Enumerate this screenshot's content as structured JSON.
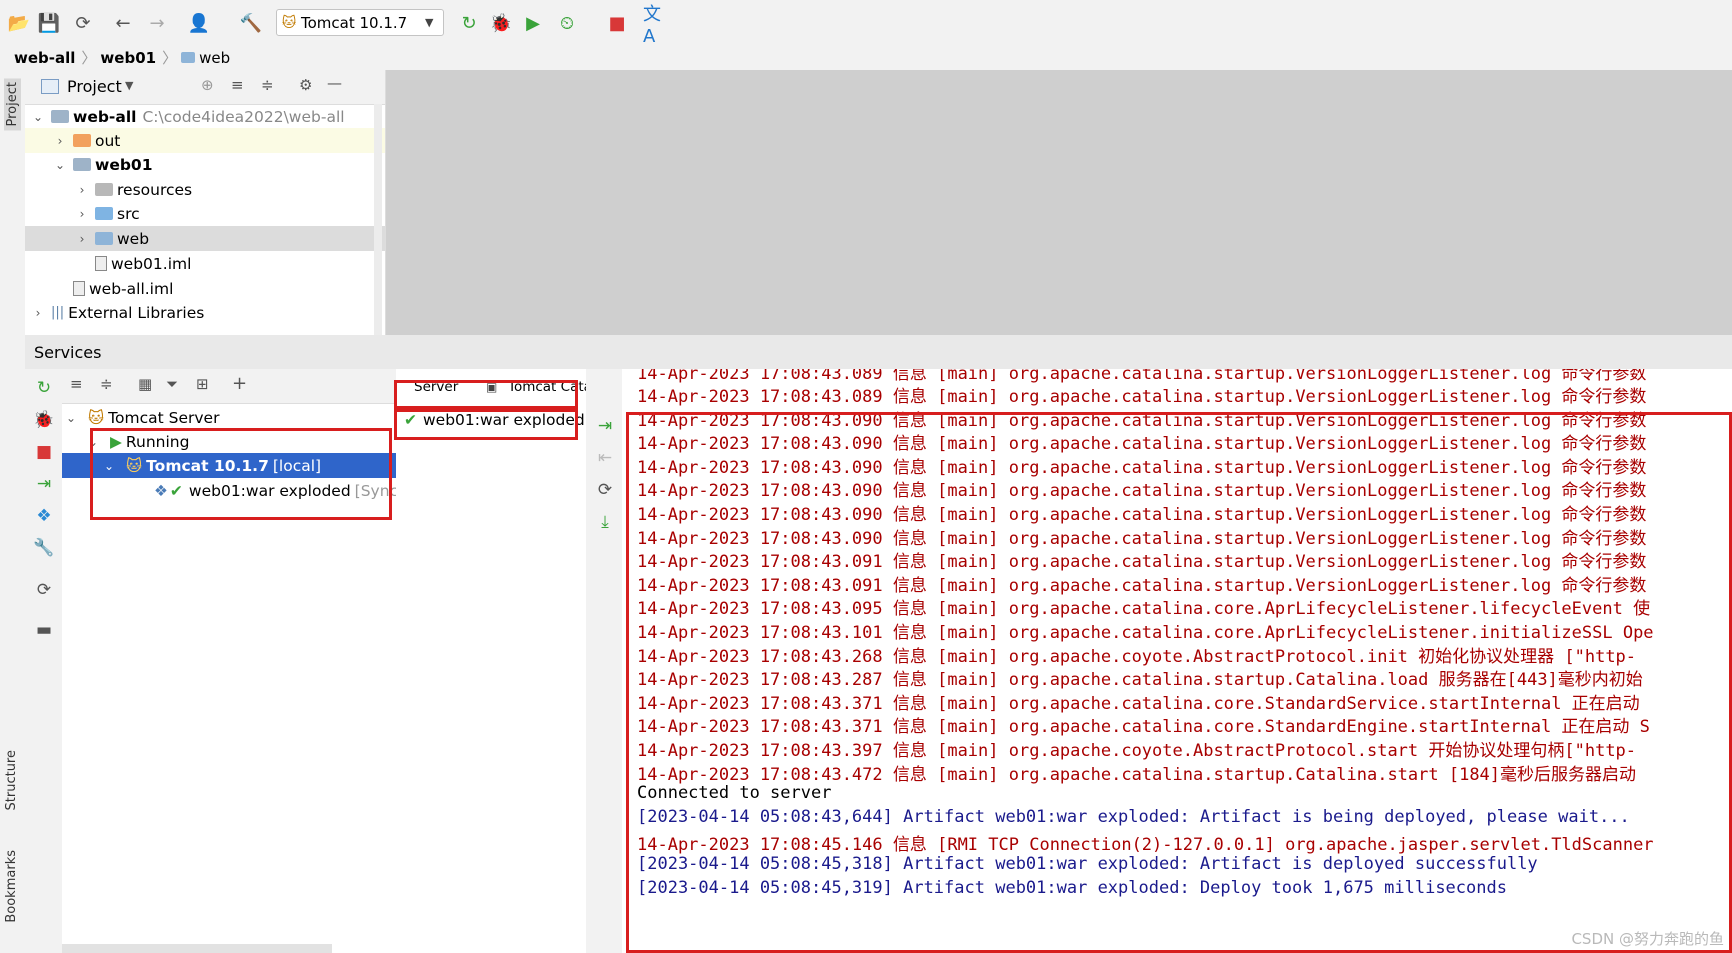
{
  "toolbar": {
    "run_config": "Tomcat 10.1.7",
    "icons": [
      "open-icon",
      "save-icon",
      "sync-icon",
      "back-icon",
      "forward-icon",
      "user-icon",
      "build-icon",
      "run-icon",
      "debug-icon",
      "coverage-icon",
      "profile-icon",
      "stop-icon",
      "translate-icon"
    ]
  },
  "breadcrumb": {
    "items": [
      "web-all",
      "web01",
      "web"
    ]
  },
  "left_strip": {
    "project_label": "Project",
    "structure_label": "Structure",
    "bookmarks_label": "Bookmarks"
  },
  "project": {
    "title": "Project",
    "tree": [
      {
        "label": "web-all",
        "extra": "C:\\code4idea2022\\web-all",
        "type": "module"
      },
      {
        "label": "out",
        "type": "folder-orange"
      },
      {
        "label": "web01",
        "type": "module"
      },
      {
        "label": "resources",
        "type": "folder-res"
      },
      {
        "label": "src",
        "type": "folder-blue"
      },
      {
        "label": "web",
        "type": "folder-web"
      },
      {
        "label": "web01.iml",
        "type": "file"
      },
      {
        "label": "web-all.iml",
        "type": "file"
      },
      {
        "label": "External Libraries",
        "type": "lib"
      }
    ]
  },
  "services": {
    "title": "Services",
    "tree": {
      "tomcat_server": "Tomcat Server",
      "running": "Running",
      "tomcat_instance": "Tomcat 10.1.7",
      "tomcat_instance_suffix": "[local]",
      "artifact": "web01:war exploded",
      "artifact_status": "[Sync"
    },
    "tabs": {
      "server": "Server",
      "catalina_log": "Tomcat Catalina Log"
    },
    "deployment": "web01:war exploded"
  },
  "console": {
    "lines": [
      {
        "text": "14-Apr-2023 17:08:43.089 信息 [main] org.apache.catalina.startup.VersionLoggerListener.log 命令行参数",
        "color": "red"
      },
      {
        "text": "14-Apr-2023 17:08:43.090 信息 [main] org.apache.catalina.startup.VersionLoggerListener.log 命令行参数",
        "color": "red"
      },
      {
        "text": "14-Apr-2023 17:08:43.090 信息 [main] org.apache.catalina.startup.VersionLoggerListener.log 命令行参数",
        "color": "red"
      },
      {
        "text": "14-Apr-2023 17:08:43.090 信息 [main] org.apache.catalina.startup.VersionLoggerListener.log 命令行参数",
        "color": "red"
      },
      {
        "text": "14-Apr-2023 17:08:43.090 信息 [main] org.apache.catalina.startup.VersionLoggerListener.log 命令行参数",
        "color": "red"
      },
      {
        "text": "14-Apr-2023 17:08:43.090 信息 [main] org.apache.catalina.startup.VersionLoggerListener.log 命令行参数",
        "color": "red"
      },
      {
        "text": "14-Apr-2023 17:08:43.090 信息 [main] org.apache.catalina.startup.VersionLoggerListener.log 命令行参数",
        "color": "red"
      },
      {
        "text": "14-Apr-2023 17:08:43.091 信息 [main] org.apache.catalina.startup.VersionLoggerListener.log 命令行参数",
        "color": "red"
      },
      {
        "text": "14-Apr-2023 17:08:43.091 信息 [main] org.apache.catalina.startup.VersionLoggerListener.log 命令行参数",
        "color": "red"
      },
      {
        "text": "14-Apr-2023 17:08:43.095 信息 [main] org.apache.catalina.core.AprLifecycleListener.lifecycleEvent 使",
        "color": "red"
      },
      {
        "text": "14-Apr-2023 17:08:43.101 信息 [main] org.apache.catalina.core.AprLifecycleListener.initializeSSL Ope",
        "color": "red"
      },
      {
        "text": "14-Apr-2023 17:08:43.268 信息 [main] org.apache.coyote.AbstractProtocol.init 初始化协议处理器 [\"http-",
        "color": "red"
      },
      {
        "text": "14-Apr-2023 17:08:43.287 信息 [main] org.apache.catalina.startup.Catalina.load 服务器在[443]毫秒内初始",
        "color": "red"
      },
      {
        "text": "14-Apr-2023 17:08:43.371 信息 [main] org.apache.catalina.core.StandardService.startInternal 正在启动",
        "color": "red"
      },
      {
        "text": "14-Apr-2023 17:08:43.371 信息 [main] org.apache.catalina.core.StandardEngine.startInternal 正在启动 S",
        "color": "red"
      },
      {
        "text": "14-Apr-2023 17:08:43.397 信息 [main] org.apache.coyote.AbstractProtocol.start 开始协议处理句柄[\"http-",
        "color": "red"
      },
      {
        "text": "14-Apr-2023 17:08:43.472 信息 [main] org.apache.catalina.startup.Catalina.start [184]毫秒后服务器启动",
        "color": "red"
      },
      {
        "text": "Connected to server",
        "color": "black"
      },
      {
        "text": "[2023-04-14 05:08:43,644] Artifact web01:war exploded: Artifact is being deployed, please wait...",
        "color": "blue"
      },
      {
        "text": "14-Apr-2023 17:08:45.146 信息 [RMI TCP Connection(2)-127.0.0.1] org.apache.jasper.servlet.TldScanner",
        "color": "red"
      },
      {
        "text": "[2023-04-14 05:08:45,318] Artifact web01:war exploded: Artifact is deployed successfully",
        "color": "blue"
      },
      {
        "text": "[2023-04-14 05:08:45,319] Artifact web01:war exploded: Deploy took 1,675 milliseconds",
        "color": "blue"
      }
    ],
    "partial_top_line": "14-Apr-2023 17:08:43.089 信息 [main] org.apache.catalina.startup.VersionLoggerListener.log 命令行参数"
  },
  "watermark": "CSDN @努力奔跑的鱼",
  "colors": {
    "selection": "#2f65ca",
    "log_red": "#a80000",
    "log_blue": "#1a1a8c",
    "highlight_box": "#d81e1e"
  }
}
